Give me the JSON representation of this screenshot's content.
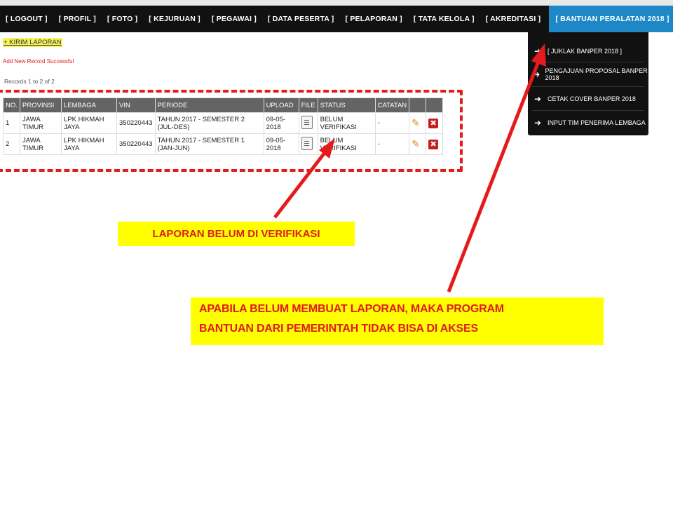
{
  "nav": {
    "items": [
      "[ LOGOUT ]",
      "[ PROFIL ]",
      "[ FOTO ]",
      "[ KEJURUAN ]",
      "[ PEGAWAI ]",
      "[ DATA PESERTA ]",
      "[ PELAPORAN ]",
      "[ TATA KELOLA ]",
      "[ AKREDITASI ]"
    ],
    "active": "[ BANTUAN PERALATAN 2018 ]"
  },
  "dropdown": {
    "items": [
      "[ JUKLAK BANPER 2018 ]",
      "PENGAJUAN PROPOSAL BANPER 2018",
      "CETAK COVER BANPER 2018",
      "INPUT TIM PENERIMA LEMBAGA"
    ]
  },
  "page": {
    "kirim_link": "+ KIRIM LAPORAN",
    "success_msg": "Add New Record Successful",
    "records_text": "Records 1 to 2 of 2"
  },
  "table": {
    "headers": [
      "NO.",
      "PROVINSI",
      "LEMBAGA",
      "VIN",
      "PERIODE",
      "UPLOAD",
      "FILE",
      "STATUS",
      "CATATAN",
      "",
      ""
    ],
    "rows": [
      {
        "no": "1",
        "provinsi": "JAWA TIMUR",
        "lembaga": "LPK HIKMAH JAYA",
        "vin": "350220443",
        "periode": "TAHUN 2017 - SEMESTER 2 (JUL-DES)",
        "upload": "09-05-2018",
        "status": "BELUM VERIFIKASI",
        "catatan": "-"
      },
      {
        "no": "2",
        "provinsi": "JAWA TIMUR",
        "lembaga": "LPK HIKMAH JAYA",
        "vin": "350220443",
        "periode": "TAHUN 2017 - SEMESTER 1 (JAN-JUN)",
        "upload": "09-05-2018",
        "status": "BELUM VERIFIKASI",
        "catatan": "-"
      }
    ]
  },
  "annotations": {
    "note1": "LAPORAN BELUM DI VERIFIKASI",
    "note2_line1": "APABILA BELUM MEMBUAT LAPORAN, MAKA PROGRAM",
    "note2_line2": "BANTUAN DARI PEMERINTAH TIDAK BISA DI AKSES"
  },
  "colors": {
    "navbar": "#111111",
    "active_tab": "#1e88c7",
    "annotation_red": "#e51b1b",
    "highlight_yellow": "#ffff00"
  }
}
